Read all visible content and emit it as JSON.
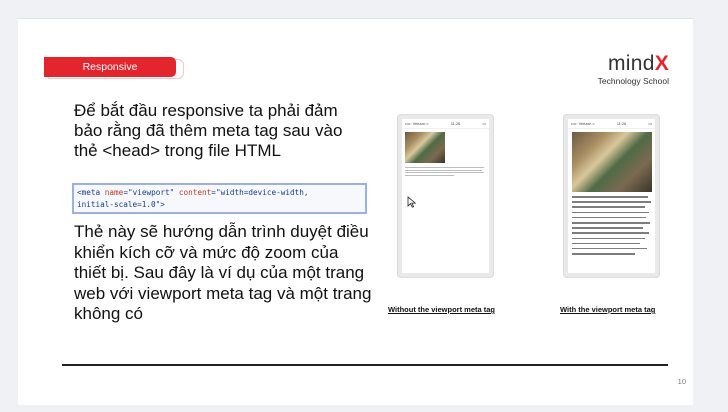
{
  "badge": {
    "label": "Responsive",
    "color": "#e3262d"
  },
  "logo": {
    "word": "mind",
    "x": "X",
    "subtitle": "Technology School"
  },
  "text": {
    "intro": "Để bắt đầu responsive ta phải đảm bảo rằng đã thêm meta tag sau vào thẻ <head> trong file HTML",
    "explanation": "Thẻ này sẽ hướng dẫn trình duyệt điều khiển kích cỡ và mức độ zoom của thiết bị. Sau đây là ví dụ của một trang web với viewport meta tag và một trang không có"
  },
  "code": {
    "open": "<meta",
    "attr1": "name",
    "val1": "\"viewport\"",
    "attr2": "content",
    "val2": "\"width=device-width,",
    "line2": "initial-scale=1.0\">"
  },
  "examples": {
    "without_caption": "Without the viewport meta tag",
    "with_caption": "With the viewport meta tag",
    "status_carrier": "••••◦ Verizon ≈",
    "status_time": "11:26",
    "status_battery": "▭"
  },
  "footer": {
    "page_number": "10"
  },
  "icons": {
    "cursor": "mouse-pointer-icon"
  }
}
